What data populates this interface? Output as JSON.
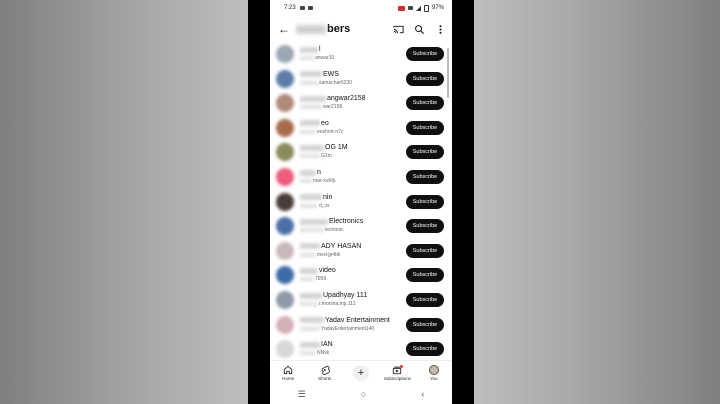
{
  "status_bar": {
    "time": "7:23",
    "battery": "97%"
  },
  "header": {
    "title_visible": "bers"
  },
  "subscribe_label": "Subscribe",
  "subscribers": [
    {
      "name": "l",
      "handle": "anwar10",
      "avatar_color": "#9aa7b5"
    },
    {
      "name": "EWS",
      "handle": "samachar6230",
      "avatar_color": "#5b7da8"
    },
    {
      "name": "angwar2158",
      "handle": "war2158",
      "avatar_color": "#b08a78"
    },
    {
      "name": "eo",
      "handle": "eoshort-n7c",
      "avatar_color": "#a86a4a"
    },
    {
      "name": "OG 1M",
      "handle": "G1m",
      "avatar_color": "#8a8a5a"
    },
    {
      "name": "n",
      "handle": "mar-xu6fp",
      "avatar_color": "#ef5b7a"
    },
    {
      "name": "nin",
      "handle": "d_vs",
      "avatar_color": "#4a3d38"
    },
    {
      "name": "Electronics",
      "handle": "lectronic",
      "avatar_color": "#4a6fa8"
    },
    {
      "name": "ADY HASAN",
      "handle": "med-jp4bk",
      "avatar_color": "#c9b8b8"
    },
    {
      "name": "video",
      "handle": "7959",
      "avatar_color": "#3d6aa8"
    },
    {
      "name": "Upadhyay 111",
      "handle": "r.monina.mp.111",
      "avatar_color": "#8e9aa8"
    },
    {
      "name": "Yadav Entertainment",
      "handle": "YadavEntertainment140",
      "avatar_color": "#d4b0b8"
    },
    {
      "name": "IAN",
      "handle": "NNsk",
      "avatar_color": "#d8d8d8"
    }
  ],
  "bottom_nav": [
    {
      "label": "Home",
      "icon": "home-icon"
    },
    {
      "label": "Shorts",
      "icon": "shorts-icon"
    },
    {
      "label": "",
      "icon": "plus-icon"
    },
    {
      "label": "Subscriptions",
      "icon": "subscriptions-icon"
    },
    {
      "label": "You",
      "icon": "you-avatar"
    }
  ]
}
